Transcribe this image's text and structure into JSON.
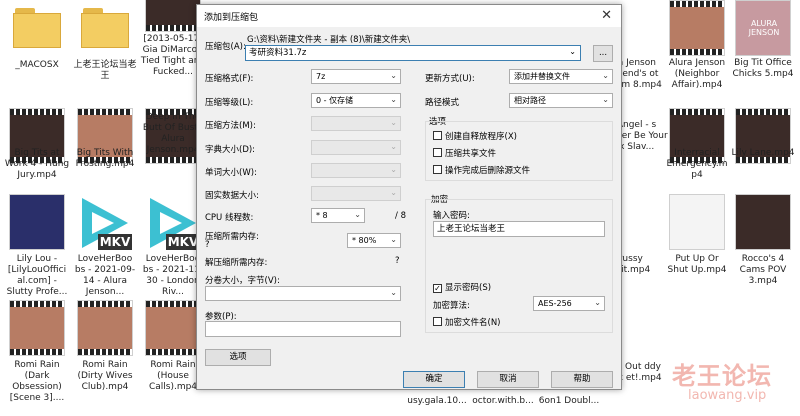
{
  "files": [
    {
      "name": "_MACOSX",
      "kind": "folder"
    },
    {
      "name": "上老王论坛当老王",
      "kind": "folder"
    },
    {
      "name": "[2013-05-17] Gia DiMarco - Tied Tight and Fucked...",
      "kind": "video"
    },
    {
      "name": "ra Jenson Friend's ot Mom 8.mp4",
      "kind": "video"
    },
    {
      "name": "Alura Jenson (Neighbor Affair).mp4",
      "kind": "video"
    },
    {
      "name": "Big Tit Office Chicks 5.mp4",
      "kind": "video"
    },
    {
      "name": "Big Tits at Work 4 - Hung Jury.mp4",
      "kind": "video"
    },
    {
      "name": "Big Tits With Frosting.mp4",
      "kind": "video"
    },
    {
      "name": "Deep In The Butt Of Busty Alura Jenson.mp4",
      "kind": "video"
    },
    {
      "name": "llAngel - s Master Be Your ex Slav...",
      "kind": "video"
    },
    {
      "name": "Interracial Emergency.m p4",
      "kind": "video"
    },
    {
      "name": "Lily Lane.mp4",
      "kind": "video"
    },
    {
      "name": "Lily Lou - [LilyLouOffici al.com] - Slutty Profe...",
      "kind": "video"
    },
    {
      "name": "LoveHerBoo bs - 2021-09-14 - Alura Jenson...",
      "kind": "mkv"
    },
    {
      "name": "LoveHerBoo bs - 2021-11-30 - London Riv...",
      "kind": "mkv"
    },
    {
      "name": "Pussy ndit.mp4",
      "kind": "video"
    },
    {
      "name": "Put Up Or Shut Up.mp4",
      "kind": "video"
    },
    {
      "name": "Rocco's 4 Cams POV 3.mp4",
      "kind": "video"
    },
    {
      "name": "Romi Rain (Dark Obsession) [Scene 3]....",
      "kind": "video"
    },
    {
      "name": "Romi Rain (Dirty Wives Club).mp4",
      "kind": "video"
    },
    {
      "name": "Romi Rain (House Calls).mp4",
      "kind": "video"
    },
    {
      "name": "usy.gala.10...",
      "kind": "video"
    },
    {
      "name": "octor.with.b...",
      "kind": "video"
    },
    {
      "name": "6on1 Doubl...",
      "kind": "video"
    },
    {
      "name": "rock Out ddy Fuck et!.mp4",
      "kind": "video"
    }
  ],
  "thumb_text": {
    "alura": "ALURA JENSON",
    "mkv": "MKV"
  },
  "watermark": {
    "cn": "老王论坛",
    "en": "laowang.vip"
  },
  "dialog": {
    "title": "添加到压缩包",
    "close": "✕",
    "archive_label": "压缩包(A):",
    "archive_path": "G:\\资料\\新建文件夹 - 副本 (8)\\新建文件夹\\",
    "archive_name": "考研资料31.7z",
    "browse": "...",
    "format_label": "压缩格式(F):",
    "format_value": "7z",
    "level_label": "压缩等级(L):",
    "level_value": "0 - 仅存储",
    "method_label": "压缩方法(M):",
    "dict_label": "字典大小(D):",
    "word_label": "单词大小(W):",
    "solid_label": "固实数据大小:",
    "threads_label": "CPU 线程数:",
    "threads_value": "* 8",
    "threads_max": "/ 8",
    "mem_label": "压缩所需内存:",
    "mem_q": "?",
    "mem_value": "* 80%",
    "decomp_label": "解压缩所需内存:",
    "decomp_q": "?",
    "split_label": "分卷大小，字节(V):",
    "params_label": "参数(P):",
    "options_btn": "选项",
    "update_label": "更新方式(U):",
    "update_value": "添加并替换文件",
    "path_label": "路径模式",
    "path_value": "相对路径",
    "options_group": "选项",
    "opt_sfx": "创建自释放程序(X)",
    "opt_shared": "压缩共享文件",
    "opt_delete": "操作完成后删除源文件",
    "enc_group": "加密",
    "pwd_label": "输入密码:",
    "pwd_value": "上老王论坛当老王",
    "show_pwd": "显示密码(S)",
    "show_pwd_check": "✓",
    "enc_method_label": "加密算法:",
    "enc_method_value": "AES-256",
    "enc_names": "加密文件名(N)",
    "ok": "确定",
    "cancel": "取消",
    "help": "帮助"
  }
}
